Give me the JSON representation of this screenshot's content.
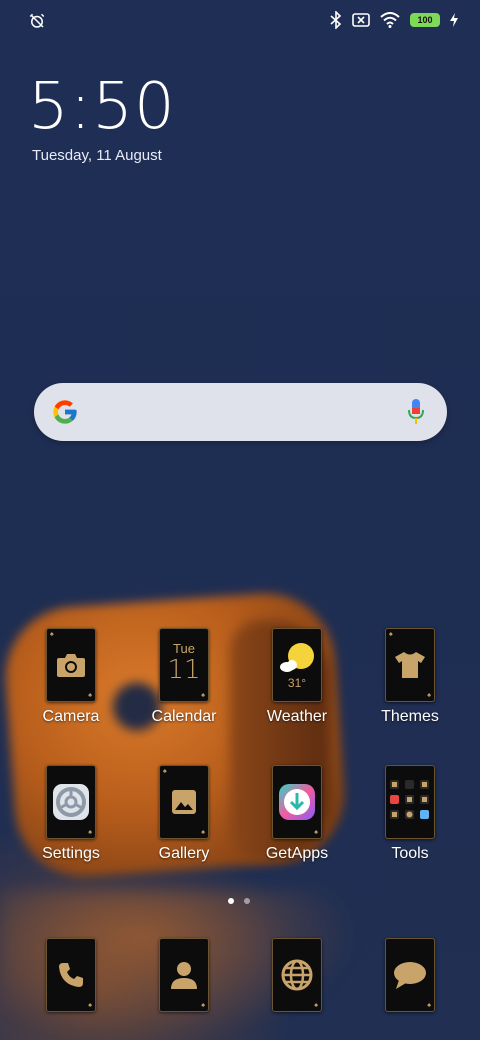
{
  "status_bar": {
    "left_icon": "alarm-off-icon",
    "right_icons": [
      "bluetooth-icon",
      "sim-x-icon",
      "wifi-icon"
    ],
    "battery_level": "100",
    "charging_icon": "bolt-icon",
    "colors": {
      "battery": "#7ed957"
    }
  },
  "clock": {
    "time": "5:50",
    "date": "Tuesday, 11 August"
  },
  "search_bar": {
    "logo": "google-logo",
    "mic": "mic-icon"
  },
  "apps_row1": [
    {
      "label": "Camera",
      "icon": "camera-icon"
    },
    {
      "label": "Calendar",
      "icon": "calendar-icon",
      "day": "Tue",
      "date": "11"
    },
    {
      "label": "Weather",
      "icon": "weather-icon",
      "temp": "31°"
    },
    {
      "label": "Themes",
      "icon": "shirt-icon"
    }
  ],
  "apps_row2": [
    {
      "label": "Settings",
      "icon": "settings-icon"
    },
    {
      "label": "Gallery",
      "icon": "gallery-icon"
    },
    {
      "label": "GetApps",
      "icon": "getapps-icon"
    },
    {
      "label": "Tools",
      "icon": "tools-folder-icon"
    }
  ],
  "page_indicator": {
    "pages": 2,
    "current": 1
  },
  "dock": [
    {
      "icon": "phone-icon"
    },
    {
      "icon": "contacts-icon"
    },
    {
      "icon": "browser-icon"
    },
    {
      "icon": "messages-icon"
    }
  ],
  "theme_colors": {
    "background": "#1e2d52",
    "card": "#0c0c0d",
    "gold": "#c9a46a"
  }
}
